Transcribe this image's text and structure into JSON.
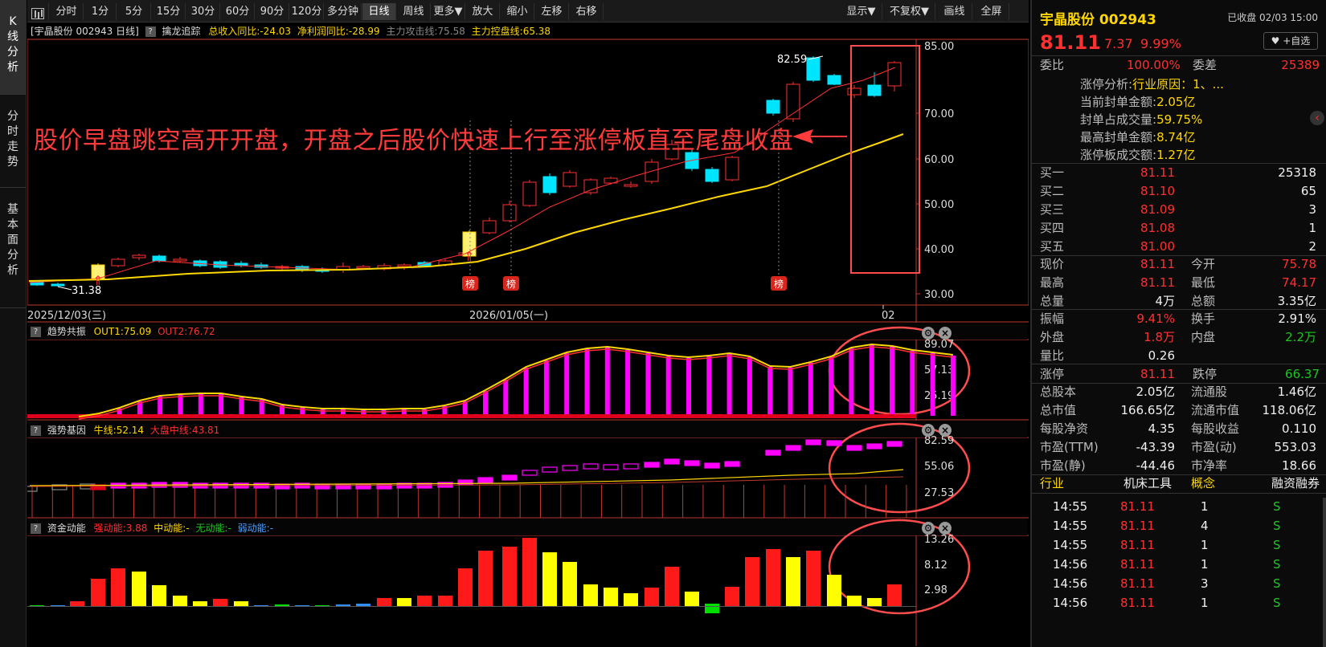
{
  "sidetabs": [
    "K线分析",
    "分时走势",
    "基本面分析"
  ],
  "toolbar": {
    "periods": [
      "分时",
      "1分",
      "5分",
      "15分",
      "30分",
      "60分",
      "90分",
      "120分",
      "多分钟",
      "日线",
      "周线",
      "更多▼"
    ],
    "actions": [
      "放大",
      "缩小",
      "左移",
      "右移"
    ],
    "right": [
      "显示▼",
      "不复权▼",
      "画线",
      "全屏"
    ]
  },
  "main_info": {
    "stock": "[宇晶股份 002943 日线]",
    "indicator": "擒龙追踪",
    "revenue": "总收入同比:-24.03",
    "profit": "净利润同比:-28.99",
    "attack": "主力攻击线:75.58",
    "control": "主力控盘线:65.38"
  },
  "price_axis": [
    "85.00",
    "70.00",
    "60.00",
    "50.00",
    "40.00",
    "30.00"
  ],
  "chart_labels": {
    "high": "82.59",
    "low": "31.38",
    "bang": "榜",
    "dates": [
      "2025/12/03(三)",
      "2026/01/05(一)",
      "02"
    ]
  },
  "annotation": "股价早盘跳空高开开盘，开盘之后股价快速上行至涨停板直至尾盘收盘",
  "panel1": {
    "name": "趋势共振",
    "out1": "OUT1:75.09",
    "out2": "OUT2:76.72",
    "axis": [
      "89.07",
      "57.13",
      "25.19"
    ]
  },
  "panel2": {
    "name": "强势基因",
    "bull": "牛线:52.14",
    "market": "大盘中线:43.81",
    "axis": [
      "82.59",
      "55.06",
      "27.53"
    ]
  },
  "panel3": {
    "name": "资金动能",
    "strong": "强动能:3.88",
    "mid": "中动能:-",
    "none": "无动能:-",
    "weak": "弱动能:-",
    "axis": [
      "13.26",
      "8.12",
      "2.98"
    ]
  },
  "quote": {
    "name": "宇晶股份 002943",
    "status": "已收盘 02/03 15:00",
    "price": "81.11",
    "change": "7.37",
    "pct": "9.99%",
    "fav": "♥ +自选",
    "webi_label": "委比",
    "webi": "100.00%",
    "wecha_label": "委差",
    "wecha": "25389",
    "limit_analysis": "涨停分析:",
    "limit_reason": "行业原因：1、...",
    "seal_amt_label": "当前封单金额:",
    "seal_amt": "2.05亿",
    "seal_vol_label": "封单占成交量:",
    "seal_vol": "59.75%",
    "max_seal_label": "最高封单金额:",
    "max_seal": "8.74亿",
    "limit_turnover_label": "涨停板成交额:",
    "limit_turnover": "1.27亿"
  },
  "bids": [
    {
      "label": "买一",
      "price": "81.11",
      "vol": "25318"
    },
    {
      "label": "买二",
      "price": "81.10",
      "vol": "65"
    },
    {
      "label": "买三",
      "price": "81.09",
      "vol": "3"
    },
    {
      "label": "买四",
      "price": "81.08",
      "vol": "1"
    },
    {
      "label": "买五",
      "price": "81.00",
      "vol": "2"
    }
  ],
  "stats1": [
    {
      "l1": "现价",
      "v1": "81.11",
      "l2": "今开",
      "v2": "75.78"
    },
    {
      "l1": "最高",
      "v1": "81.11",
      "l2": "最低",
      "v2": "74.17"
    },
    {
      "l1": "总量",
      "v1": "4万",
      "l2": "总额",
      "v2": "3.35亿"
    }
  ],
  "stats2": [
    {
      "l1": "振幅",
      "v1": "9.41%",
      "l2": "换手",
      "v2": "2.91%"
    },
    {
      "l1": "外盘",
      "v1": "1.8万",
      "l2": "内盘",
      "v2": "2.2万"
    },
    {
      "l1": "量比",
      "v1": "0.26",
      "l2": "",
      "v2": ""
    }
  ],
  "limits": {
    "l1": "涨停",
    "v1": "81.11",
    "l2": "跌停",
    "v2": "66.37"
  },
  "stats3": [
    {
      "l1": "总股本",
      "v1": "2.05亿",
      "l2": "流通股",
      "v2": "1.46亿"
    },
    {
      "l1": "总市值",
      "v1": "166.65亿",
      "l2": "流通市值",
      "v2": "118.06亿"
    },
    {
      "l1": "每股净资",
      "v1": "4.35",
      "l2": "每股收益",
      "v2": "0.110"
    },
    {
      "l1": "市盈(TTM)",
      "v1": "-43.39",
      "l2": "市盈(动)",
      "v2": "553.03"
    },
    {
      "l1": "市盈(静)",
      "v1": "-44.46",
      "l2": "市净率",
      "v2": "18.66"
    }
  ],
  "industry": {
    "label": "行业",
    "value": "机床工具",
    "concept": "概念",
    "margin": "融资融券"
  },
  "ticks": [
    {
      "time": "14:55",
      "price": "81.11",
      "vol": "1",
      "bs": "S"
    },
    {
      "time": "14:55",
      "price": "81.11",
      "vol": "4",
      "bs": "S"
    },
    {
      "time": "14:55",
      "price": "81.11",
      "vol": "1",
      "bs": "S"
    },
    {
      "time": "14:56",
      "price": "81.11",
      "vol": "1",
      "bs": "S"
    },
    {
      "time": "14:56",
      "price": "81.11",
      "vol": "3",
      "bs": "S"
    },
    {
      "time": "14:56",
      "price": "81.11",
      "vol": "1",
      "bs": "S"
    }
  ]
}
